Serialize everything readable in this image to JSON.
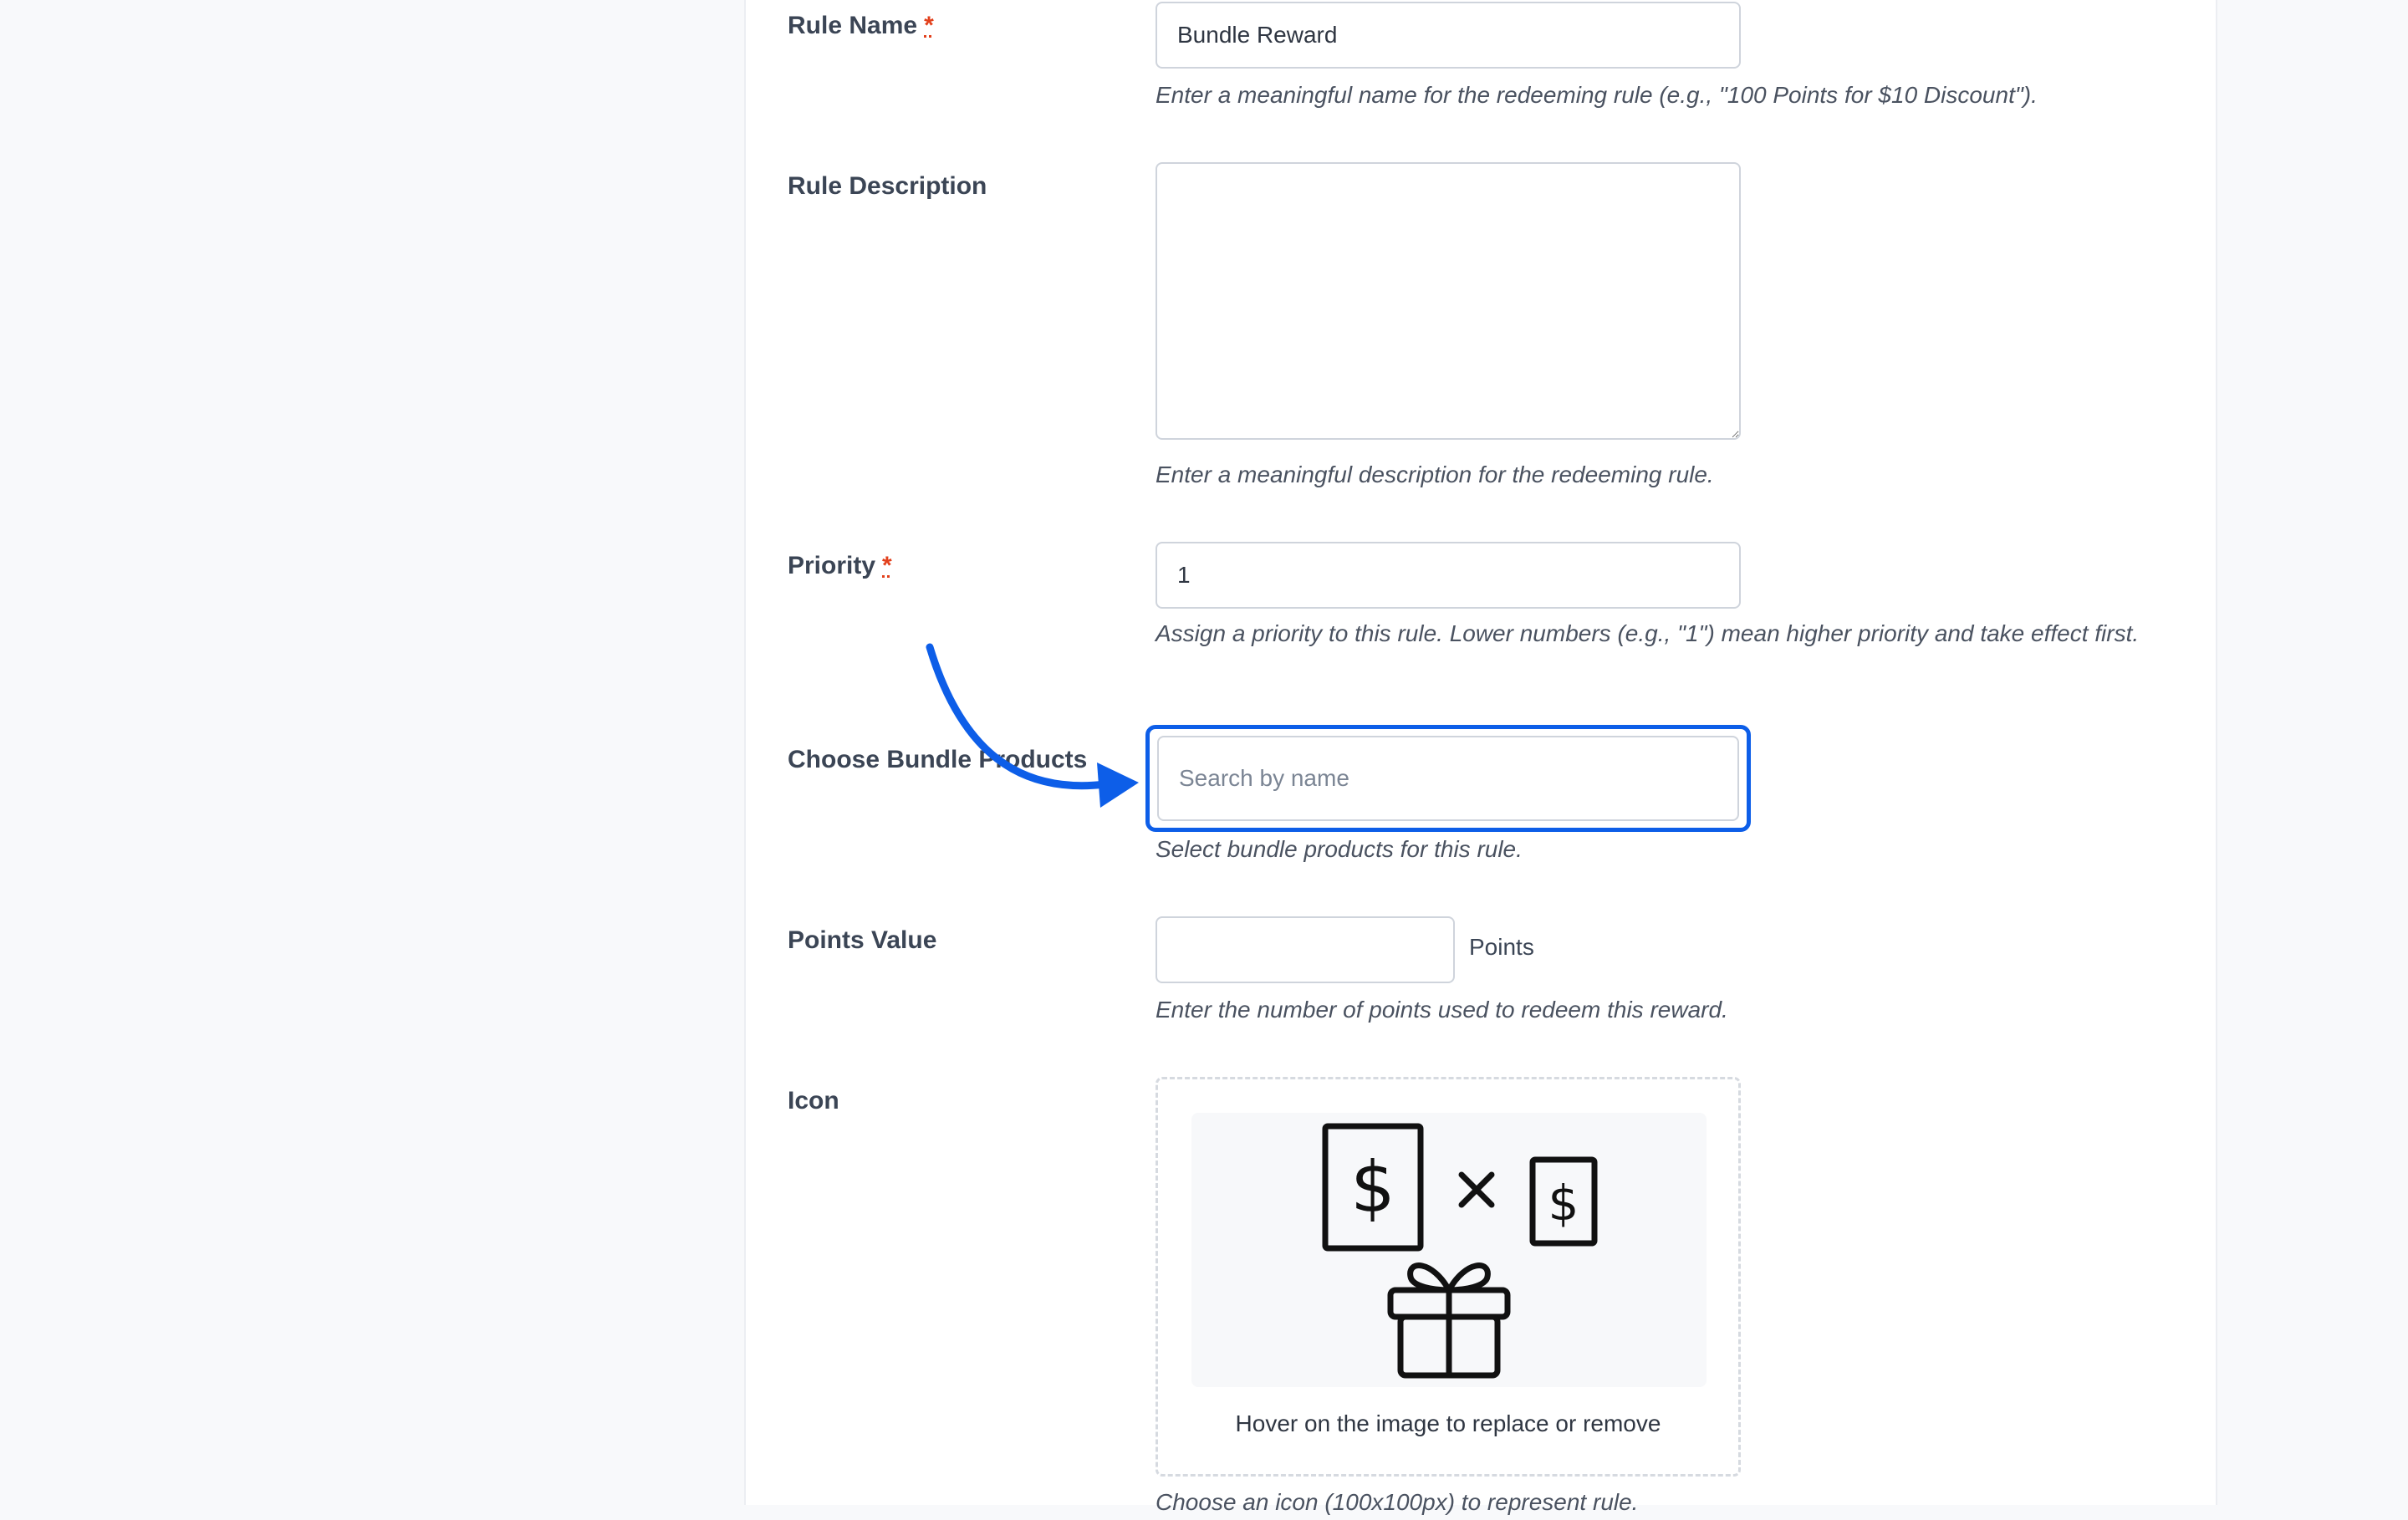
{
  "form": {
    "rule_name": {
      "label": "Rule Name",
      "required_mark": "*",
      "value": "Bundle Reward",
      "help": "Enter a meaningful name for the redeeming rule (e.g., \"100 Points for $10 Discount\")."
    },
    "rule_description": {
      "label": "Rule Description",
      "value": "",
      "help": "Enter a meaningful description for the redeeming rule."
    },
    "priority": {
      "label": "Priority",
      "required_mark": "*",
      "value": "1",
      "help": "Assign a priority to this rule. Lower numbers (e.g., \"1\") mean higher priority and take effect first."
    },
    "bundle_products": {
      "label": "Choose Bundle Products",
      "placeholder": "Search by name",
      "help": "Select bundle products for this rule."
    },
    "points_value": {
      "label": "Points Value",
      "value": "",
      "suffix": "Points",
      "help": "Enter the number of points used to redeem this reward."
    },
    "icon": {
      "label": "Icon",
      "image_icon": "bundle-reward-icon",
      "caption": "Hover on the image to replace or remove",
      "help": "Choose an icon (100x100px) to represent rule."
    }
  },
  "annotation": {
    "arrow_color": "#0d5ee8",
    "highlight_color": "#0d5ee8"
  },
  "colors": {
    "required": "#e2401c",
    "label": "#3b4555",
    "help": "#4a5260",
    "border": "#cfd4dc"
  }
}
